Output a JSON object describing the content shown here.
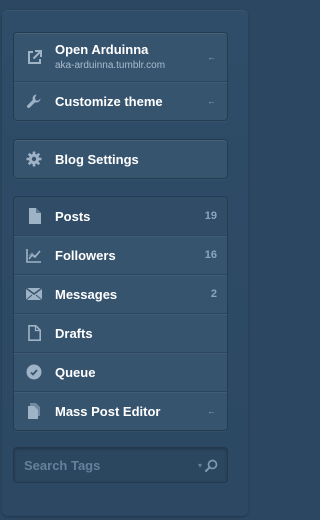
{
  "top_group": [
    {
      "label": "Open Arduinna",
      "sub": "aka-arduinna.tumblr.com",
      "icon": "external-link-icon",
      "arrow": "←"
    },
    {
      "label": "Customize theme",
      "icon": "wrench-icon",
      "arrow": "←"
    }
  ],
  "settings": {
    "label": "Blog Settings",
    "icon": "gear-icon"
  },
  "nav": [
    {
      "label": "Posts",
      "count": "19",
      "icon": "document-icon"
    },
    {
      "label": "Followers",
      "count": "16",
      "icon": "chart-icon"
    },
    {
      "label": "Messages",
      "count": "2",
      "icon": "envelope-icon"
    },
    {
      "label": "Drafts",
      "icon": "draft-icon"
    },
    {
      "label": "Queue",
      "icon": "clock-icon"
    },
    {
      "label": "Mass Post Editor",
      "icon": "documents-icon",
      "arrow": "←"
    }
  ],
  "search": {
    "placeholder": "Search Tags",
    "caret": "▾",
    "icon": "search-icon"
  }
}
